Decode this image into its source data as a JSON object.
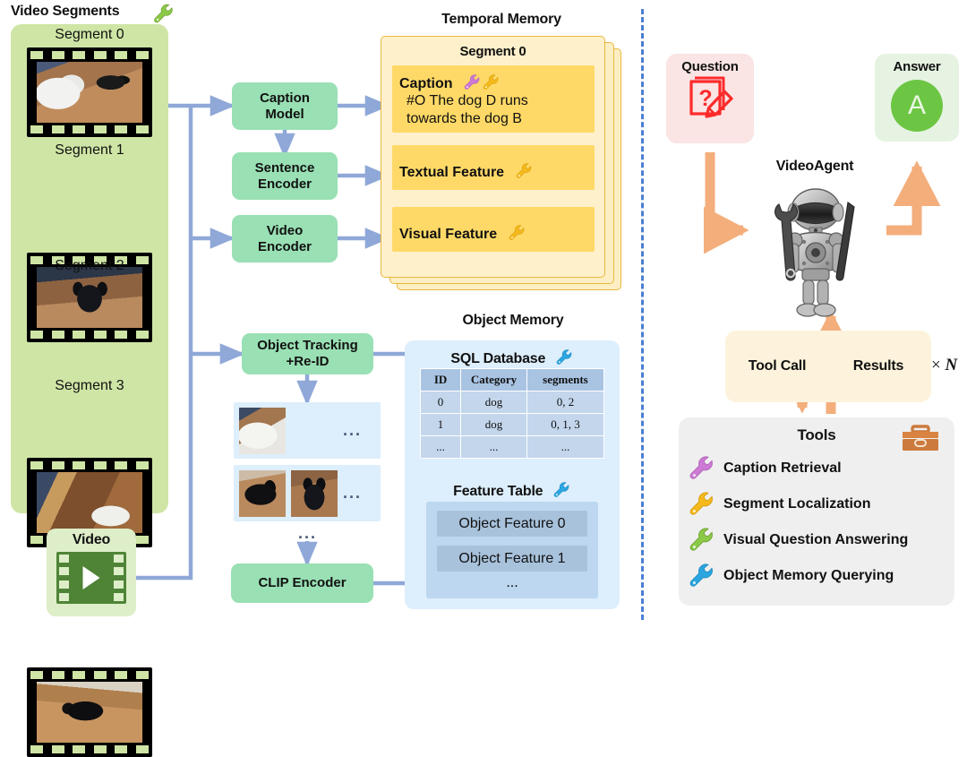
{
  "left_panel": {
    "title": "Video Segments",
    "title_icon": "wrench-icon-green",
    "segments": [
      {
        "label": "Segment 0"
      },
      {
        "label": "Segment 1"
      },
      {
        "label": "Segment 2"
      },
      {
        "label": "Segment 3"
      }
    ],
    "video_source": {
      "label": "Video",
      "icon": "video-play-icon"
    }
  },
  "models": {
    "caption_model": "Caption\nModel",
    "caption_model_l1": "Caption",
    "caption_model_l2": "Model",
    "sentence_encoder_l1": "Sentence",
    "sentence_encoder_l2": "Encoder",
    "video_encoder_l1": "Video",
    "video_encoder_l2": "Encoder",
    "object_tracking_l1": "Object Tracking",
    "object_tracking_l2": "+Re-ID",
    "clip_encoder": "CLIP Encoder"
  },
  "temporal_memory": {
    "title": "Temporal Memory",
    "card_title": "Segment 0",
    "rows": [
      {
        "label": "Caption",
        "icons": [
          "wrench-icon-purple",
          "wrench-icon-orange"
        ],
        "text_line1": "#O The dog D runs",
        "text_line2": "towards the dog B"
      },
      {
        "label": "Textual Feature",
        "icons": [
          "wrench-icon-orange"
        ]
      },
      {
        "label": "Visual Feature",
        "icons": [
          "wrench-icon-orange"
        ]
      }
    ]
  },
  "object_memory": {
    "title": "Object Memory",
    "sql": {
      "title": "SQL Database",
      "icon": "wrench-icon-blue",
      "columns": [
        "ID",
        "Category",
        "segments"
      ],
      "rows": [
        [
          "0",
          "dog",
          "0, 2"
        ],
        [
          "1",
          "dog",
          "0, 1, 3"
        ],
        [
          "...",
          "...",
          "..."
        ]
      ]
    },
    "feature_table": {
      "title": "Feature Table",
      "icon": "wrench-icon-blue",
      "rows": [
        "Object Feature 0",
        "Object Feature 1",
        "..."
      ]
    },
    "crops_ellipsis": "...",
    "crops_column_ellipsis": "..."
  },
  "right_panel": {
    "question": {
      "label": "Question",
      "icon": "question-note-pencil-icon"
    },
    "answer": {
      "label": "Answer",
      "icon": "answer-circle-icon",
      "circle_letter": "A"
    },
    "agent": {
      "label": "VideoAgent",
      "icon": "robot-icon"
    },
    "loop": {
      "tool_call": "Tool Call",
      "results": "Results",
      "repeat": "× N",
      "repeat_symbol": "×",
      "repeat_n": "N"
    },
    "tools": {
      "title": "Tools",
      "icon": "toolbox-icon",
      "items": [
        {
          "label": "Caption Retrieval",
          "icon": "wrench-icon-purple",
          "color": "#cc7ad4"
        },
        {
          "label": "Segment Localization",
          "icon": "wrench-icon-orange",
          "color": "#f5b91b"
        },
        {
          "label": "Visual Question Answering",
          "icon": "wrench-icon-green",
          "color": "#8cc947"
        },
        {
          "label": "Object Memory Querying",
          "icon": "wrench-icon-blue",
          "color": "#2ba6e0"
        }
      ]
    }
  },
  "colors": {
    "segment_panel": "#cfe5a5",
    "model_box": "#99e0b4",
    "temporal_card": "#fdf0cb",
    "temporal_row": "#ffd967",
    "object_card": "#ddeefc",
    "question_box": "#fbe4e4",
    "answer_box": "#e6f3e2",
    "tools_box": "#efefef",
    "arrow_blue": "#8fa8d8",
    "arrow_orange": "#f3ae7c",
    "divider": "#4a7fd4"
  }
}
